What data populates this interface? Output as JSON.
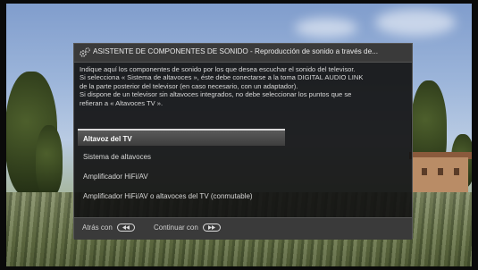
{
  "dialog": {
    "title": "ASISTENTE DE COMPONENTES DE SONIDO - Reproducción de sonido a través de...",
    "description_lines": [
      "Indique aquí los componentes de sonido por los que desea escuchar el sonido del televisor.",
      "Si selecciona « Sistema de altavoces », éste debe conectarse a la toma DIGITAL AUDIO LINK",
      "de la parte posterior del televisor (en caso necesario, con un adaptador).",
      "Si dispone de un televisor sin altavoces integrados, no debe seleccionar los puntos que se",
      "refieran a « Altavoces TV »."
    ],
    "options": [
      {
        "label": "Altavoz del TV",
        "selected": true
      },
      {
        "label": "Sistema de altavoces",
        "selected": false
      },
      {
        "label": "Amplificador HiFi/AV",
        "selected": false
      },
      {
        "label": "Amplificador HiFi/AV o altavoces del TV (conmutable)",
        "selected": false
      }
    ],
    "footer": {
      "back_label": "Atrás con",
      "continue_label": "Continuar con"
    }
  },
  "icons": {
    "title_icon": "gears-icon",
    "back_key": "rewind-key-icon",
    "continue_key": "fast-forward-key-icon"
  }
}
